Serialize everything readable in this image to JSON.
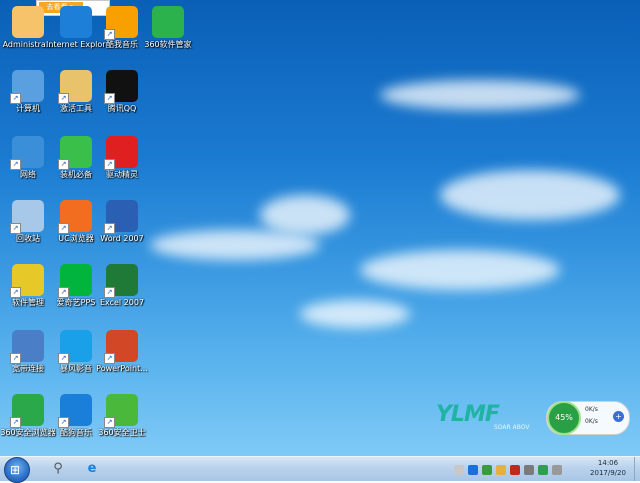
{
  "desktop": {
    "top_banner_text": "去看看 >",
    "brand_logo": "YLMF",
    "brand_tagline": "SOAR ABOV",
    "icons": [
      {
        "label": "Administra...",
        "icon": "user-folder-icon",
        "color": "#f6c36a"
      },
      {
        "label": "Internet Explorer",
        "icon": "ie-icon",
        "color": "#1e7fd8"
      },
      {
        "label": "酷我音乐",
        "icon": "music-icon",
        "color": "#f7a000"
      },
      {
        "label": "360软件管家",
        "icon": "360-manager-icon",
        "color": "#2bb24c"
      },
      {
        "label": "计算机",
        "icon": "computer-icon",
        "color": "#5aa0e0"
      },
      {
        "label": "激活工具",
        "icon": "activation-tool-icon",
        "color": "#e9c36b"
      },
      {
        "label": "腾讯QQ",
        "icon": "qq-penguin-icon",
        "color": "#111111"
      },
      {
        "label": "网络",
        "icon": "network-icon",
        "color": "#3a8fd8"
      },
      {
        "label": "装机必备",
        "icon": "shopping-bag-icon",
        "color": "#3ac04a"
      },
      {
        "label": "驱动精灵",
        "icon": "driver-tool-icon",
        "color": "#e02020"
      },
      {
        "label": "回收站",
        "icon": "recycle-bin-icon",
        "color": "#a7c8e8"
      },
      {
        "label": "UC浏览器",
        "icon": "uc-browser-icon",
        "color": "#f36d21"
      },
      {
        "label": "Word 2007",
        "icon": "word-icon",
        "color": "#2b5fb4"
      },
      {
        "label": "软件管理",
        "icon": "software-icon",
        "color": "#e6c829"
      },
      {
        "label": "爱奇艺PPS",
        "icon": "iqiyi-icon",
        "color": "#00b43c"
      },
      {
        "label": "Excel 2007",
        "icon": "excel-icon",
        "color": "#1f7a38"
      },
      {
        "label": "宽带连接",
        "icon": "broadband-icon",
        "color": "#4a7ec6"
      },
      {
        "label": "暴风影音",
        "icon": "video-player-icon",
        "color": "#1aa0e8"
      },
      {
        "label": "PowerPoint...",
        "icon": "powerpoint-icon",
        "color": "#d24726"
      },
      {
        "label": "360安全浏览器",
        "icon": "360-browser-icon",
        "color": "#2aa84a"
      },
      {
        "label": "酷狗音乐",
        "icon": "kugou-icon",
        "color": "#1a7fd8"
      },
      {
        "label": "360安全卫士",
        "icon": "360-guard-icon",
        "color": "#4ab83a"
      }
    ]
  },
  "speed_widget": {
    "percent": "45%",
    "upload": "0K/s",
    "download": "0K/s",
    "plus": "+"
  },
  "taskbar": {
    "start_label": "⊞",
    "time": "14:06",
    "date": "2017/9/20",
    "pinned": [
      {
        "name": "search-icon",
        "glyph": "⚲",
        "color": "#555555"
      },
      {
        "name": "ie-icon",
        "glyph": "e",
        "color": "#1e7fd8"
      }
    ],
    "tray_icons": [
      "#c8c8c8",
      "#1c6fd8",
      "#3a9b3a",
      "#e3b23c",
      "#c1271e",
      "#7a7a7a",
      "#2ca04c",
      "#999999"
    ]
  }
}
